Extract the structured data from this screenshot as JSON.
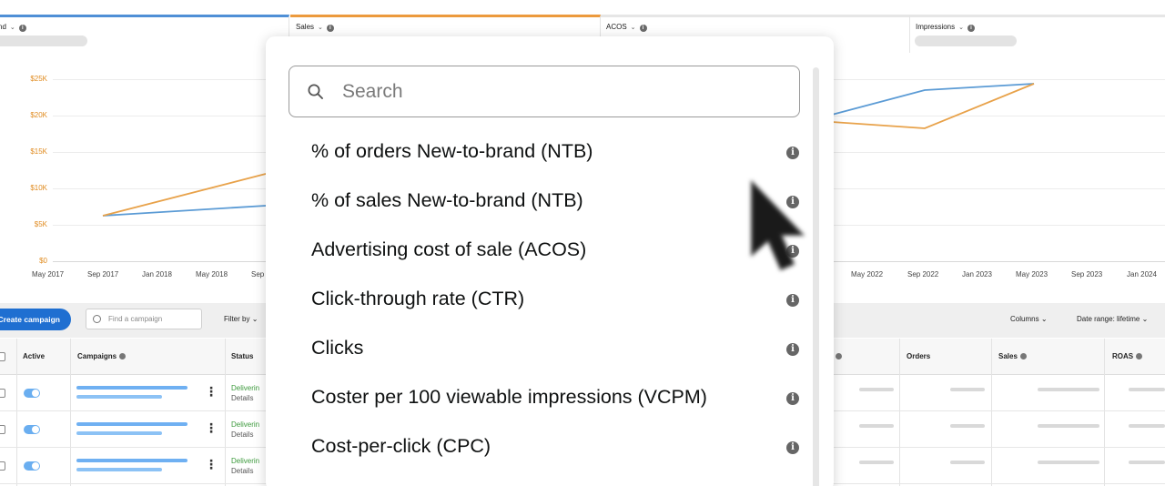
{
  "metrics": [
    {
      "label": "nd"
    },
    {
      "label": "Sales"
    },
    {
      "label": "ACOS"
    },
    {
      "label": "Impressions"
    }
  ],
  "chart": {
    "y_ticks": [
      "$25K",
      "$20K",
      "$15K",
      "$10K",
      "$5K",
      "$0"
    ],
    "x_ticks": [
      "May 2017",
      "Sep 2017",
      "Jan 2018",
      "May 2018",
      "Sep",
      "May 2022",
      "Sep 2022",
      "Jan 2023",
      "May 2023",
      "Sep 2023",
      "Jan 2024"
    ],
    "colors": {
      "blue": "#5b9bd5",
      "orange": "#e8a24a",
      "axis": "#e08a1e"
    }
  },
  "toolbar": {
    "create_campaign": "Create campaign",
    "find_placeholder": "Find a campaign",
    "filter_by": "Filter by",
    "columns": "Columns",
    "date_range": "Date range: lifetime"
  },
  "table": {
    "headers": {
      "active": "Active",
      "campaigns": "Campaigns",
      "status": "Status",
      "orders": "Orders",
      "sales": "Sales",
      "roas": "ROAS"
    },
    "rows": [
      {
        "status": "Deliverin",
        "details": "Details"
      },
      {
        "status": "Deliverin",
        "details": "Details"
      },
      {
        "status": "Deliverin",
        "details": "Details"
      }
    ]
  },
  "dropdown": {
    "search_placeholder": "Search",
    "options": [
      {
        "label": "% of orders New-to-brand (NTB)"
      },
      {
        "label": "% of sales New-to-brand (NTB)"
      },
      {
        "label": "Advertising cost of sale (ACOS)"
      },
      {
        "label": "Click-through rate (CTR)"
      },
      {
        "label": "Clicks"
      },
      {
        "label": "Coster per 100 viewable impressions (VCPM)"
      },
      {
        "label": "Cost-per-click (CPC)"
      }
    ]
  },
  "colors": {
    "accent": "#1f6fd1",
    "status_green": "#3c9a3c",
    "info_icon": "#666666"
  }
}
